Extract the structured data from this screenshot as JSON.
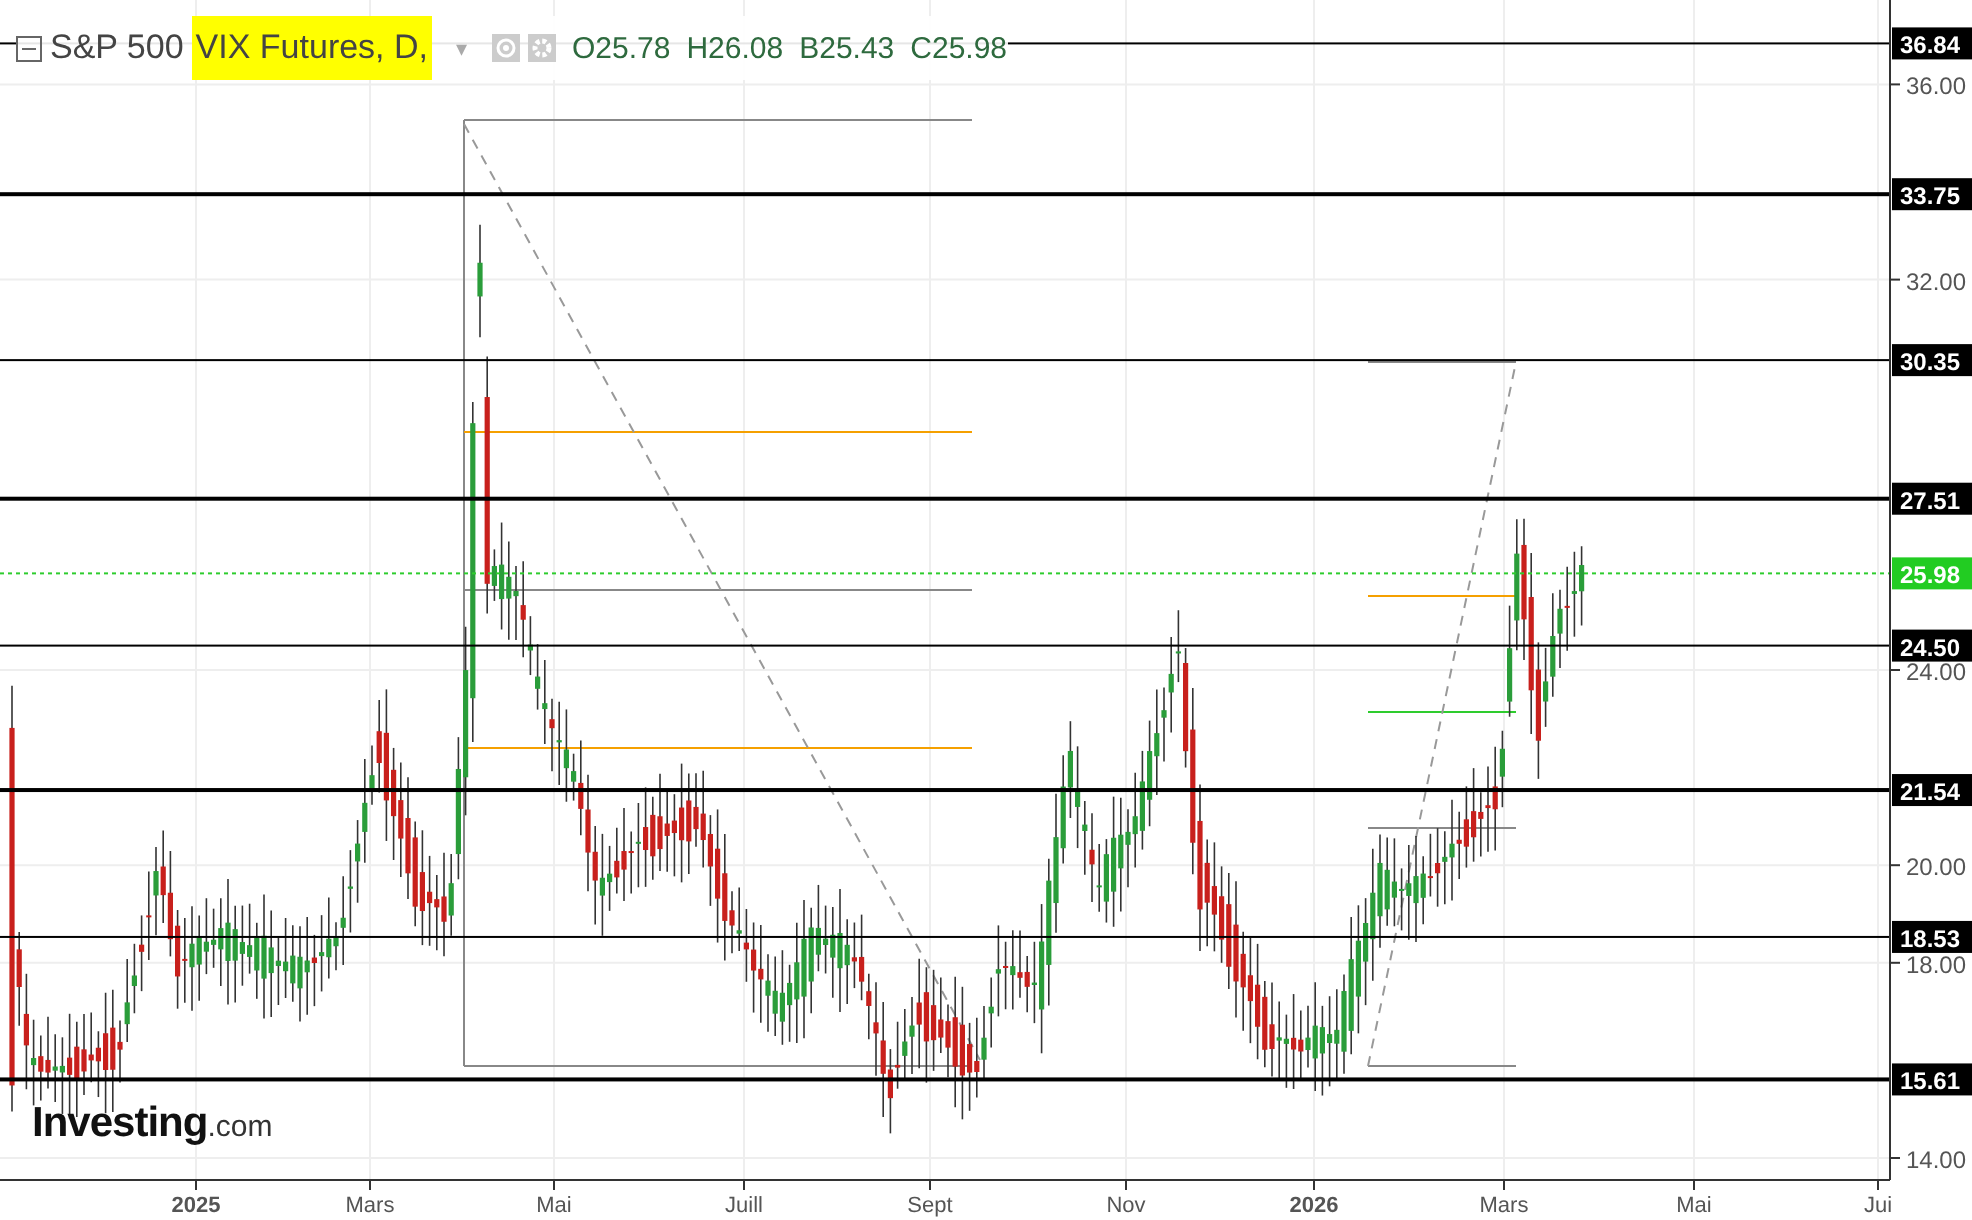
{
  "header": {
    "title": "S&P 500",
    "highlighted_title": "VIX Futures, D,",
    "dropdown": "▾",
    "ohlc": [
      "O25.78",
      "H26.08",
      "B25.43",
      "C25.98"
    ]
  },
  "chart": {
    "y_ticks": [
      "36.00",
      "32.00",
      "24.00",
      "20.00",
      "18.00",
      "14.00"
    ],
    "x_labels": [
      {
        "label": "2025",
        "bold": true
      },
      {
        "label": "Mars",
        "bold": false
      },
      {
        "label": "Mai",
        "bold": false
      },
      {
        "label": "Juill",
        "bold": false
      },
      {
        "label": "Sept",
        "bold": false
      },
      {
        "label": "Nov",
        "bold": false
      },
      {
        "label": "2026",
        "bold": true
      },
      {
        "label": "Mars",
        "bold": false
      },
      {
        "label": "Mai",
        "bold": false
      },
      {
        "label": "Jui",
        "bold": false
      }
    ],
    "levels": [
      {
        "label": "36.84",
        "kind": "level",
        "heavy": false
      },
      {
        "label": "33.75",
        "kind": "level",
        "heavy": true
      },
      {
        "label": "30.35",
        "kind": "level",
        "heavy": false
      },
      {
        "label": "27.51",
        "kind": "level",
        "heavy": true
      },
      {
        "label": "25.98",
        "kind": "current",
        "heavy": false
      },
      {
        "label": "24.50",
        "kind": "level",
        "heavy": false
      },
      {
        "label": "21.54",
        "kind": "level",
        "heavy": true
      },
      {
        "label": "18.53",
        "kind": "level",
        "heavy": false
      },
      {
        "label": "15.61",
        "kind": "level",
        "heavy": true
      }
    ]
  },
  "logo": {
    "brand": "Investing",
    "suffix": ".com"
  }
}
